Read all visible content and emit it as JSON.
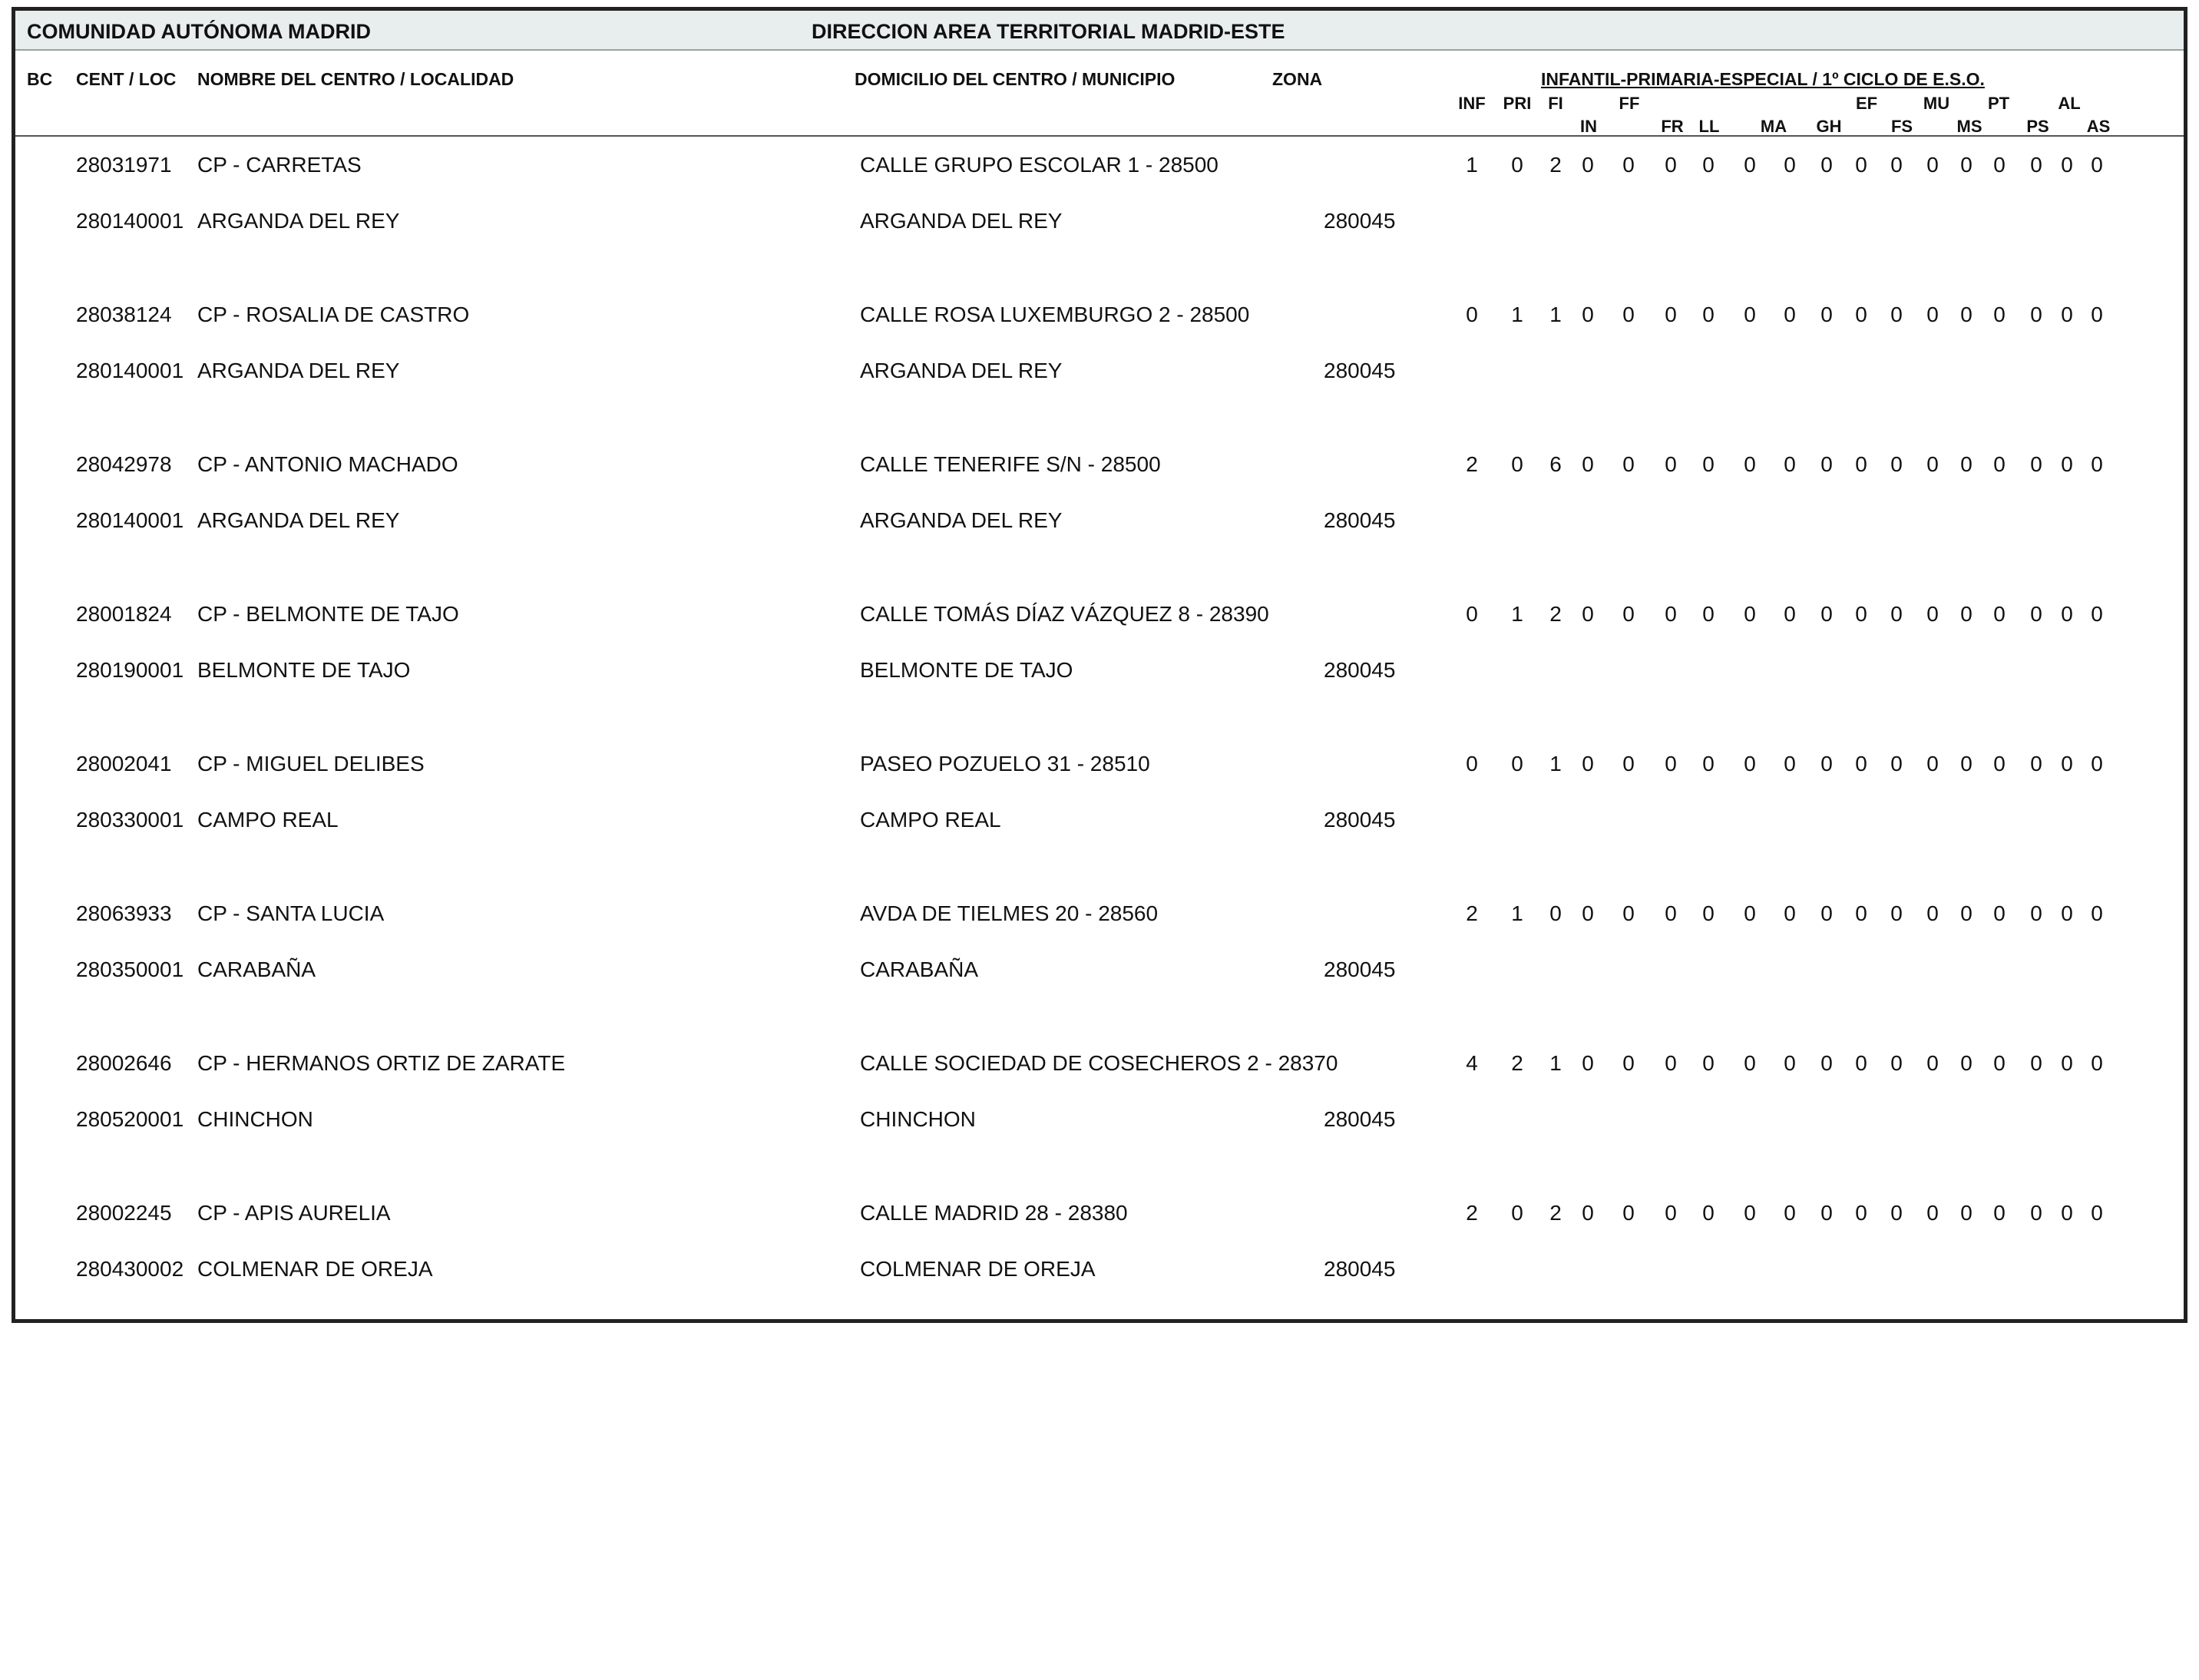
{
  "header": {
    "left_title": "COMUNIDAD AUTÓNOMA MADRID",
    "right_title": "DIRECCION AREA TERRITORIAL MADRID-ESTE",
    "col_bc": "BC",
    "col_cent": "CENT / LOC",
    "col_nombre": "NOMBRE DEL CENTRO / LOCALIDAD",
    "col_domicilio": "DOMICILIO DEL CENTRO / MUNICIPIO",
    "col_zona": "ZONA",
    "group_title": "INFANTIL-PRIMARIA-ESPECIAL / 1º CICLO DE E.S.O."
  },
  "codes_top": [
    "INF",
    "PRI",
    "FI",
    "FF",
    "EF",
    "MU",
    "PT",
    "AL"
  ],
  "codes_bottom": [
    "IN",
    "FR",
    "LL",
    "MA",
    "GH",
    "FS",
    "MS",
    "PS",
    "AS"
  ],
  "centers": [
    {
      "cent": "28031971",
      "name": "CP - CARRETAS",
      "address": "CALLE GRUPO ESCOLAR 1 - 28500",
      "loc": "280140001",
      "locality": "ARGANDA DEL REY",
      "municipality": "ARGANDA DEL REY",
      "zona": "280045",
      "values": [
        "1",
        "0",
        "2",
        "0",
        "0",
        "0",
        "0",
        "0",
        "0",
        "0",
        "0",
        "0",
        "0",
        "0",
        "0",
        "0",
        "0",
        "0"
      ]
    },
    {
      "cent": "28038124",
      "name": "CP - ROSALIA DE CASTRO",
      "address": "CALLE ROSA LUXEMBURGO 2 - 28500",
      "loc": "280140001",
      "locality": "ARGANDA DEL REY",
      "municipality": "ARGANDA DEL REY",
      "zona": "280045",
      "values": [
        "0",
        "1",
        "1",
        "0",
        "0",
        "0",
        "0",
        "0",
        "0",
        "0",
        "0",
        "0",
        "0",
        "0",
        "0",
        "0",
        "0",
        "0"
      ]
    },
    {
      "cent": "28042978",
      "name": "CP - ANTONIO MACHADO",
      "address": "CALLE TENERIFE S/N - 28500",
      "loc": "280140001",
      "locality": "ARGANDA DEL REY",
      "municipality": "ARGANDA DEL REY",
      "zona": "280045",
      "values": [
        "2",
        "0",
        "6",
        "0",
        "0",
        "0",
        "0",
        "0",
        "0",
        "0",
        "0",
        "0",
        "0",
        "0",
        "0",
        "0",
        "0",
        "0"
      ]
    },
    {
      "cent": "28001824",
      "name": "CP - BELMONTE DE TAJO",
      "address": "CALLE TOMÁS DÍAZ VÁZQUEZ 8 - 28390",
      "loc": "280190001",
      "locality": "BELMONTE DE TAJO",
      "municipality": "BELMONTE DE TAJO",
      "zona": "280045",
      "values": [
        "0",
        "1",
        "2",
        "0",
        "0",
        "0",
        "0",
        "0",
        "0",
        "0",
        "0",
        "0",
        "0",
        "0",
        "0",
        "0",
        "0",
        "0"
      ]
    },
    {
      "cent": "28002041",
      "name": "CP - MIGUEL DELIBES",
      "address": "PASEO POZUELO 31 - 28510",
      "loc": "280330001",
      "locality": "CAMPO REAL",
      "municipality": "CAMPO REAL",
      "zona": "280045",
      "values": [
        "0",
        "0",
        "1",
        "0",
        "0",
        "0",
        "0",
        "0",
        "0",
        "0",
        "0",
        "0",
        "0",
        "0",
        "0",
        "0",
        "0",
        "0"
      ]
    },
    {
      "cent": "28063933",
      "name": "CP - SANTA LUCIA",
      "address": "AVDA DE TIELMES 20 - 28560",
      "loc": "280350001",
      "locality": "CARABAÑA",
      "municipality": "CARABAÑA",
      "zona": "280045",
      "values": [
        "2",
        "1",
        "0",
        "0",
        "0",
        "0",
        "0",
        "0",
        "0",
        "0",
        "0",
        "0",
        "0",
        "0",
        "0",
        "0",
        "0",
        "0"
      ]
    },
    {
      "cent": "28002646",
      "name": "CP - HERMANOS ORTIZ DE ZARATE",
      "address": "CALLE SOCIEDAD DE COSECHEROS 2 - 28370",
      "loc": "280520001",
      "locality": "CHINCHON",
      "municipality": "CHINCHON",
      "zona": "280045",
      "values": [
        "4",
        "2",
        "1",
        "0",
        "0",
        "0",
        "0",
        "0",
        "0",
        "0",
        "0",
        "0",
        "0",
        "0",
        "0",
        "0",
        "0",
        "0"
      ]
    },
    {
      "cent": "28002245",
      "name": "CP - APIS AURELIA",
      "address": "CALLE MADRID 28 - 28380",
      "loc": "280430002",
      "locality": "COLMENAR DE OREJA",
      "municipality": "COLMENAR DE OREJA",
      "zona": "280045",
      "values": [
        "2",
        "0",
        "2",
        "0",
        "0",
        "0",
        "0",
        "0",
        "0",
        "0",
        "0",
        "0",
        "0",
        "0",
        "0",
        "0",
        "0",
        "0"
      ]
    }
  ]
}
